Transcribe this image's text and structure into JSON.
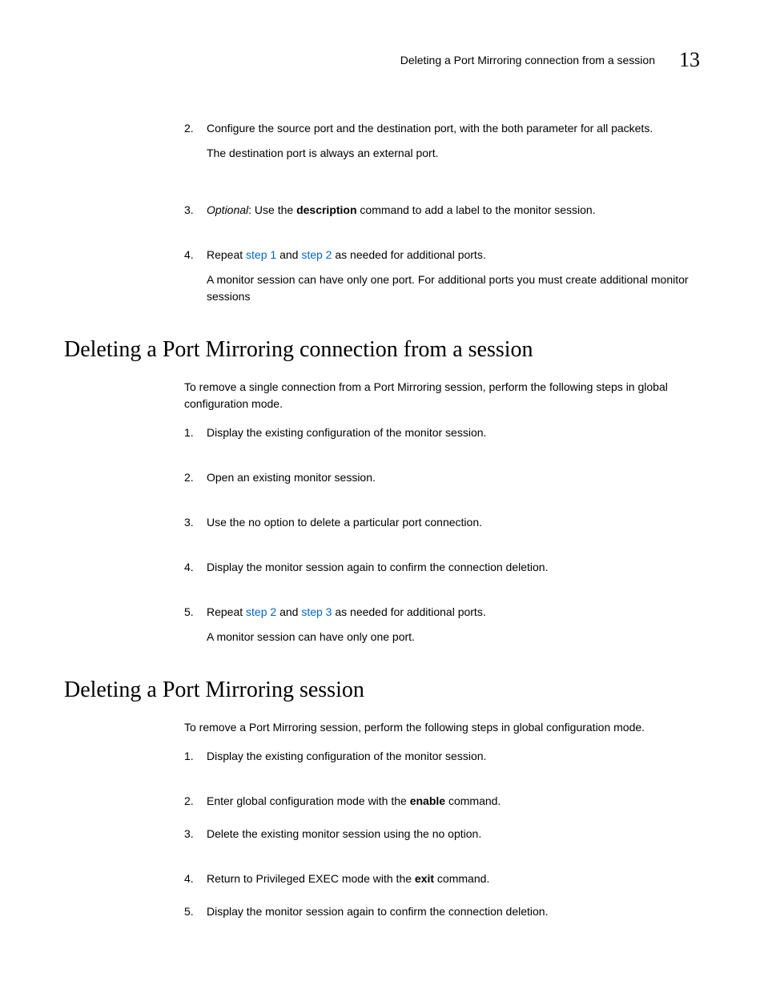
{
  "header": {
    "title": "Deleting a Port Mirroring connection from a session",
    "page_number": "13"
  },
  "top_list": [
    {
      "num": "2.",
      "text_pre": "Configure the source port and the destination port, with the both parameter for all packets.",
      "sub": "The destination port is always an external port."
    },
    {
      "num": "3.",
      "optional": "Optional",
      "text_mid1": ": Use the ",
      "bold1": "description",
      "text_mid2": " command to add a label to the monitor session."
    },
    {
      "num": "4.",
      "text_pre": "Repeat ",
      "link1": "step 1",
      "text_mid": " and ",
      "link2": "step 2",
      "text_post": " as needed for additional ports.",
      "sub": "A monitor session can have only one port. For additional ports you must create additional monitor sessions"
    }
  ],
  "section1": {
    "heading": "Deleting a Port Mirroring connection from a session",
    "intro": "To remove a single connection from a Port Mirroring session, perform the following steps in global configuration mode.",
    "items": [
      {
        "num": "1.",
        "text": "Display the existing configuration of the monitor session."
      },
      {
        "num": "2.",
        "text": "Open an existing monitor session."
      },
      {
        "num": "3.",
        "text": "Use the no option to delete a particular port connection."
      },
      {
        "num": "4.",
        "text": "Display the monitor session again to confirm the connection deletion."
      },
      {
        "num": "5.",
        "text_pre": "Repeat ",
        "link1": "step 2",
        "text_mid": " and ",
        "link2": "step 3",
        "text_post": " as needed for additional ports.",
        "sub": "A monitor session can have only one port."
      }
    ]
  },
  "section2": {
    "heading": "Deleting a Port Mirroring session",
    "intro": "To remove a Port Mirroring session, perform the following steps in global configuration mode.",
    "items": [
      {
        "num": "1.",
        "text": "Display the existing configuration of the monitor session."
      },
      {
        "num": "2.",
        "text_pre": "Enter global configuration mode with the ",
        "bold": "enable",
        "text_post": " command."
      },
      {
        "num": "3.",
        "text": "Delete the existing monitor session using the no option."
      },
      {
        "num": "4.",
        "text_pre": "Return to Privileged EXEC mode with the ",
        "bold": "exit",
        "text_post": " command."
      },
      {
        "num": "5.",
        "text": "Display the monitor session again to confirm the connection deletion."
      }
    ]
  }
}
